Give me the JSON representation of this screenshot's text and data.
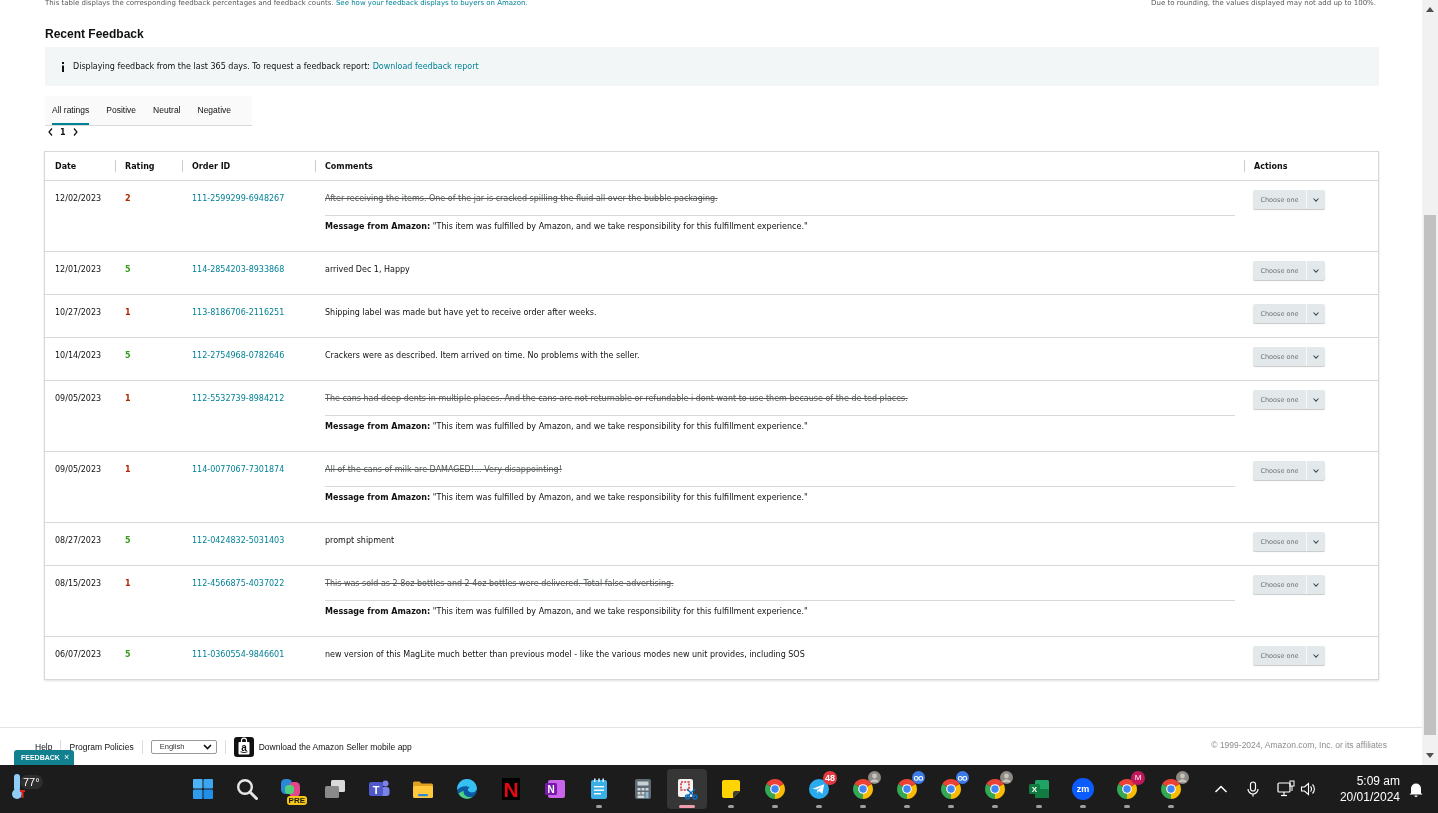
{
  "summary_note": {
    "text": "This table displays the corresponding feedback percentages and feedback counts.",
    "link": "See how your feedback displays to buyers on Amazon."
  },
  "rounding_note": "Due to rounding, the values displayed may not add up to 100%.",
  "section_title": "Recent Feedback",
  "info_banner": {
    "text": "Displaying feedback from the last 365 days. To request a feedback report:",
    "link": "Download feedback report"
  },
  "tabs": [
    {
      "label": "All ratings",
      "selected": true
    },
    {
      "label": "Positive",
      "selected": false
    },
    {
      "label": "Neutral",
      "selected": false
    },
    {
      "label": "Negative",
      "selected": false
    }
  ],
  "pagination": {
    "page": "1"
  },
  "table": {
    "columns": [
      "Date",
      "Rating",
      "Order ID",
      "Comments",
      "Actions"
    ],
    "rows": [
      {
        "date": "12/02/2023",
        "rating": "2",
        "color": "#b12704",
        "order_id": "111-2599299-6948267",
        "comment": "After receiving the items. One of the jar is cracked spilling the fluid all over the bubble packaging.",
        "struck": true,
        "message": "**Message from Amazon:** \"This item was fulfilled by Amazon, and we take responsibility for this fulfillment experience.\"",
        "action": "Choose one"
      },
      {
        "date": "12/01/2023",
        "rating": "5",
        "color": "#3a9a1c",
        "order_id": "114-2854203-8933868",
        "comment": "arrived Dec 1, Happy",
        "struck": false,
        "action": "Choose one"
      },
      {
        "date": "10/27/2023",
        "rating": "1",
        "color": "#b12704",
        "order_id": "113-8186706-2116251",
        "comment": "Shipping label was made but have yet to receive order after weeks.",
        "struck": false,
        "action": "Choose one"
      },
      {
        "date": "10/14/2023",
        "rating": "5",
        "color": "#3a9a1c",
        "order_id": "112-2754968-0782646",
        "comment": "Crackers were as described. Item arrived on time. No problems with the seller.",
        "struck": false,
        "action": "Choose one"
      },
      {
        "date": "09/05/2023",
        "rating": "1",
        "color": "#b12704",
        "order_id": "112-5532739-8984212",
        "comment": "The cans had deep dents in multiple places. And the cans are not returnable or refundable i dont want to use them because of the de ted places.",
        "struck": true,
        "message": "**Message from Amazon:** \"This item was fulfilled by Amazon, and we take responsibility for this fulfillment experience.\"",
        "action": "Choose one"
      },
      {
        "date": "09/05/2023",
        "rating": "1",
        "color": "#b12704",
        "order_id": "114-0077067-7301874",
        "comment": "All of the cans of milk are DAMAGED!... Very disappointing!",
        "struck": true,
        "message": "**Message from Amazon:** \"This item was fulfilled by Amazon, and we take responsibility for this fulfillment experience.\"",
        "action": "Choose one"
      },
      {
        "date": "08/27/2023",
        "rating": "5",
        "color": "#3a9a1c",
        "order_id": "112-0424832-5031403",
        "comment": "prompt shipment",
        "struck": false,
        "action": "Choose one"
      },
      {
        "date": "08/15/2023",
        "rating": "1",
        "color": "#b12704",
        "order_id": "112-4566875-4037022",
        "comment": "This was sold as 2 8oz bottles and 2 4oz bottles were delivered. Total false advertising.",
        "struck": true,
        "message": "**Message from Amazon:** \"This item was fulfilled by Amazon, and we take responsibility for this fulfillment experience.\"",
        "action": "Choose one"
      },
      {
        "date": "06/07/2023",
        "rating": "5",
        "color": "#3a9a1c",
        "order_id": "111-0360554-9846601",
        "comment": "new version of this MagLite much better than previous model - like the various modes new unit provides, including SOS",
        "struck": false,
        "action": "Choose one"
      }
    ]
  },
  "footer": {
    "links": [
      "Help",
      "Program Policies"
    ],
    "language": "English",
    "app_glyph": "a",
    "app_promo": "Download the Amazon Seller mobile app",
    "copyright": "© 1999-2024, Amazon.com, Inc. or its affiliates"
  },
  "feedback_tab": {
    "label": "FEEDBACK",
    "close": "×"
  },
  "taskbar": {
    "weather": "77°",
    "apps": [
      {
        "kind": "start",
        "running": false,
        "active": false
      },
      {
        "kind": "search",
        "running": false,
        "active": false
      },
      {
        "kind": "copilot",
        "badge": "PRE",
        "running": false,
        "active": false
      },
      {
        "kind": "taskview",
        "running": false,
        "active": false
      },
      {
        "kind": "teams",
        "glyph": "T",
        "running": false,
        "active": false
      },
      {
        "kind": "explorer",
        "running": false,
        "active": false
      },
      {
        "kind": "edge",
        "running": false,
        "active": false
      },
      {
        "kind": "netflix",
        "glyph": "N",
        "running": false,
        "active": false
      },
      {
        "kind": "onenote",
        "glyph": "N",
        "running": false,
        "active": false
      },
      {
        "kind": "notepad",
        "running": true,
        "active": false
      },
      {
        "kind": "calculator",
        "running": false,
        "active": false
      },
      {
        "kind": "snipping",
        "running": true,
        "active": true
      },
      {
        "kind": "sticky",
        "running": true,
        "active": false
      },
      {
        "kind": "chrome",
        "running": true,
        "active": false
      },
      {
        "kind": "telegram",
        "badge": "48",
        "running": true,
        "active": false
      },
      {
        "kind": "chrome",
        "avatar": {
          "kind": "photo"
        },
        "running": true,
        "active": false
      },
      {
        "kind": "chrome",
        "avatar": {
          "kind": "glasses"
        },
        "running": true,
        "active": false
      },
      {
        "kind": "chrome",
        "avatar": {
          "kind": "glasses"
        },
        "running": true,
        "active": false
      },
      {
        "kind": "chrome",
        "avatar": {
          "kind": "photo"
        },
        "running": true,
        "active": false
      },
      {
        "kind": "excel",
        "glyph": "X",
        "running": true,
        "active": false
      },
      {
        "kind": "zoom",
        "glyph": "zm",
        "running": true,
        "active": false
      },
      {
        "kind": "chrome",
        "badge": "M",
        "running": true,
        "active": false
      },
      {
        "kind": "chrome",
        "avatar": {
          "kind": "photo"
        },
        "running": true,
        "active": false
      }
    ],
    "clock": {
      "time": "5:09 am",
      "date": "20/01/2024"
    }
  }
}
